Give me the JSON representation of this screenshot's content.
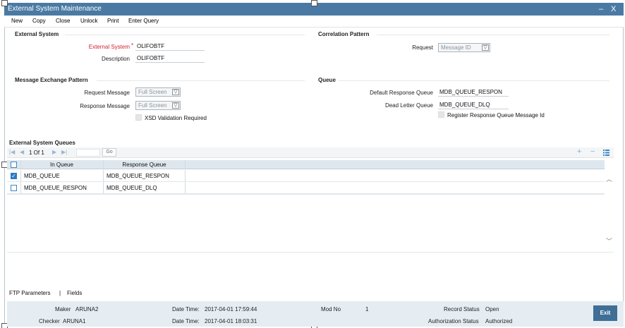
{
  "window": {
    "title": "External System Maintenance",
    "minimize": "–",
    "close": "X"
  },
  "toolbar": {
    "new": "New",
    "copy": "Copy",
    "close": "Close",
    "unlock": "Unlock",
    "print": "Print",
    "enter_query": "Enter Query"
  },
  "external_system": {
    "section_title": "External System",
    "system_label": "External System",
    "required_mark": "*",
    "system_value": "OLIFOBTF",
    "description_label": "Description",
    "description_value": "OLIFOBTF"
  },
  "correlation": {
    "section_title": "Correlation Pattern",
    "request_label": "Request",
    "request_value": "Message ID"
  },
  "message_exchange": {
    "section_title": "Message Exchange Pattern",
    "request_label": "Request Message",
    "request_value": "Full Screen",
    "response_label": "Response Message",
    "response_value": "Full Screen",
    "xsd_label": "XSD Validation Required"
  },
  "queue": {
    "section_title": "Queue",
    "default_response_label": "Default Response Queue",
    "default_response_value": "MDB_QUEUE_RESPON",
    "dead_letter_label": "Dead Letter Queue",
    "dead_letter_value": "MDB_QUEUE_DLQ",
    "register_label": "Register Response Queue Message Id"
  },
  "queues_grid": {
    "section_title": "External System Queues",
    "page_text": "1 Of 1",
    "go_label": "Go",
    "add_icon": "+",
    "remove_icon": "−",
    "columns": [
      "In Queue",
      "Response Queue"
    ],
    "rows": [
      {
        "checked": true,
        "in_queue": "MDB_QUEUE",
        "response_queue": "MDB_QUEUE_RESPON"
      },
      {
        "checked": false,
        "in_queue": "MDB_QUEUE_RESPON",
        "response_queue": "MDB_QUEUE_DLQ"
      }
    ]
  },
  "links": {
    "ftp": "FTP Parameters",
    "separator": "|",
    "fields": "Fields"
  },
  "footer": {
    "maker_label": "Maker",
    "maker_value": "ARUNA2",
    "checker_label": "Checker",
    "checker_value": "ARUNA1",
    "dt_label": "Date Time:",
    "maker_dt": "2017-04-01 17:59:44",
    "checker_dt": "2017-04-01 18:03:31",
    "modno_label": "Mod No",
    "modno_value": "1",
    "record_status_label": "Record Status",
    "record_status_value": "Open",
    "auth_status_label": "Authorization Status",
    "auth_status_value": "Authorized",
    "exit_label": "Exit"
  },
  "colors": {
    "titlebar": "#4a7aa3",
    "accent": "#2c7bc4",
    "required": "#cc2233",
    "footer": "#e5edf2"
  }
}
